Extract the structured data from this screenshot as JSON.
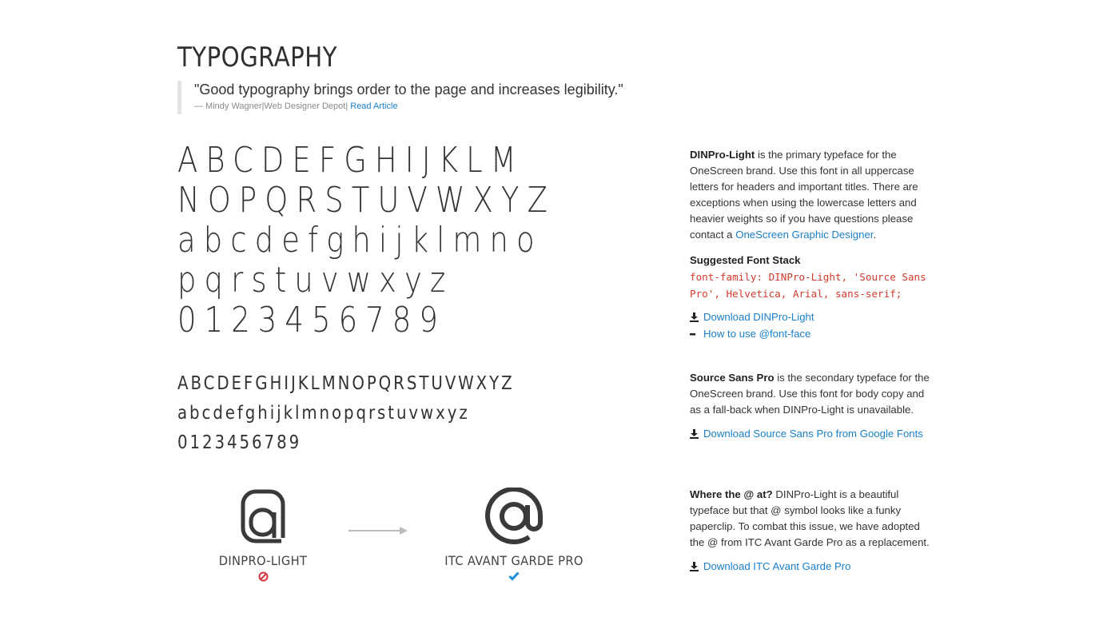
{
  "page": {
    "title": "TYPOGRAPHY",
    "quote": {
      "text": "\"Good typography brings order to the page and increases legibility.\"",
      "author": "— Mindy Wagner",
      "source": "Web Designer Depot",
      "separator": "|",
      "link_label": "Read Article"
    }
  },
  "specimens": {
    "primary": [
      "ABCDEFGHIJKLM",
      "NOPQRSTUVWXYZ",
      "abcdefghijklmno",
      "pqrstuvwxyz",
      "0123456789"
    ],
    "secondary": [
      "ABCDEFGHIJKLMNOPQRSTUVWXYZ",
      "abcdefghijklmnopqrstuvwxyz",
      "0123456789"
    ]
  },
  "at_symbol": {
    "old": {
      "glyph": "@",
      "name": "DINPRO-LIGHT",
      "status_icon": "no-entry-icon"
    },
    "new": {
      "glyph": "@",
      "name": "ITC AVANT GARDE PRO",
      "status_icon": "checkmark-icon"
    }
  },
  "sidebar": {
    "primary": {
      "font_name": "DINPro-Light",
      "description": " is the primary typeface for the OneScreen brand. Use this font in all uppercase letters for headers and important titles. There are exceptions when using the lowercase letters and heavier weights so if you have questions please contact a ",
      "contact_link": "OneScreen Graphic Designer",
      "period": ".",
      "stack_title": "Suggested Font Stack",
      "stack_code": "font-family: DINPro-Light, 'Source Sans Pro', Helvetica, Arial, sans-serif;",
      "download_label": "Download DINPro-Light",
      "fontface_label": "How to use @font-face"
    },
    "secondary": {
      "font_name": "Source Sans Pro",
      "description": " is the secondary typeface for the OneScreen brand. Use this font for body copy and as a fall-back when DINPro-Light is unavailable.",
      "download_label": "Download Source Sans Pro from Google Fonts"
    },
    "at": {
      "heading": "Where the @ at?",
      "description": " DINPro-Light is a beautiful typeface but that @ symbol looks like a funky paperclip. To combat this issue, we have adopted the @ from ITC Avant Garde Pro as a replacement.",
      "download_label": "Download ITC Avant Garde Pro"
    }
  },
  "colors": {
    "link": "#1a7fc9",
    "code": "#d33a2c",
    "no_entry": "#d9363e",
    "check": "#1a8fd8"
  }
}
